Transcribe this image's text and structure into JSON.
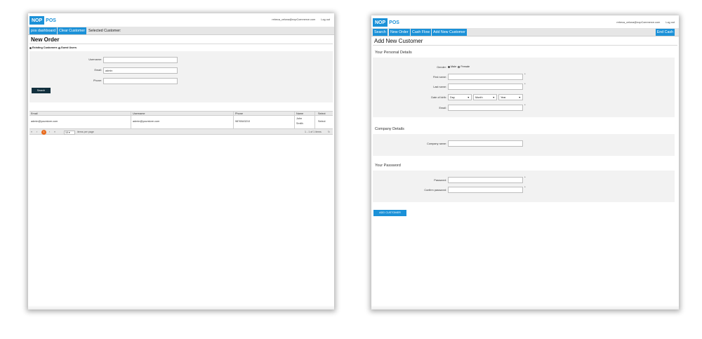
{
  "left": {
    "logo": {
      "part1": "NOP",
      "part2": "POS"
    },
    "user_email": "rebeca_celona@nopCommerce.com",
    "logout": "Log out",
    "nav": {
      "pos_dashboard": "pos dashboard",
      "clear_customer": "Clear Customer",
      "selected_customer": "Selected Customer:"
    },
    "title": "New Order",
    "radios": {
      "existing": "Existing Customers",
      "guest": "Guest Users"
    },
    "form": {
      "username_label": "Username:",
      "email_label": "Email:",
      "email_value": "admin",
      "phone_label": "Phone:",
      "search_button": "Search"
    },
    "table": {
      "columns": [
        "Email",
        "Username",
        "Phone",
        "Name",
        "Select"
      ],
      "rows": [
        {
          "email": "admin@yourstore.com",
          "username": "admin@yourstore.com",
          "phone": "9876543210",
          "name_first": "John",
          "name_last": "Smith",
          "select": "Select"
        }
      ]
    },
    "pager": {
      "first": "«",
      "prev": "‹",
      "current": "1",
      "next": "›",
      "last": "»",
      "page_size": "10",
      "items_per_page": "items per page",
      "summary": "1 - 1 of 1 items",
      "refresh": "↻"
    }
  },
  "right": {
    "logo": {
      "part1": "NOP",
      "part2": "POS"
    },
    "user_email": "rebeca_celona@nopCommerce.com",
    "logout": "Log out",
    "nav": {
      "search": "Search",
      "new_order": "New Order",
      "cash_flow": "Cash Flow",
      "add_new_customer": "Add New Customer",
      "end_cash": "End Cash"
    },
    "title": "Add New Customer",
    "personal": {
      "heading": "Your Personal Details",
      "gender_label": "Gender:",
      "male": "Male",
      "female": "Female",
      "first_name_label": "First name:",
      "last_name_label": "Last name:",
      "dob_label": "Date of birth:",
      "day": "Day",
      "month": "Month",
      "year": "Year",
      "email_label": "Email:"
    },
    "company": {
      "heading": "Company Details",
      "name_label": "Company name:"
    },
    "password": {
      "heading": "Your Password",
      "password_label": "Password:",
      "confirm_label": "Confirm password:"
    },
    "required_mark": "*",
    "add_button": "ADD CUSTOMER"
  }
}
